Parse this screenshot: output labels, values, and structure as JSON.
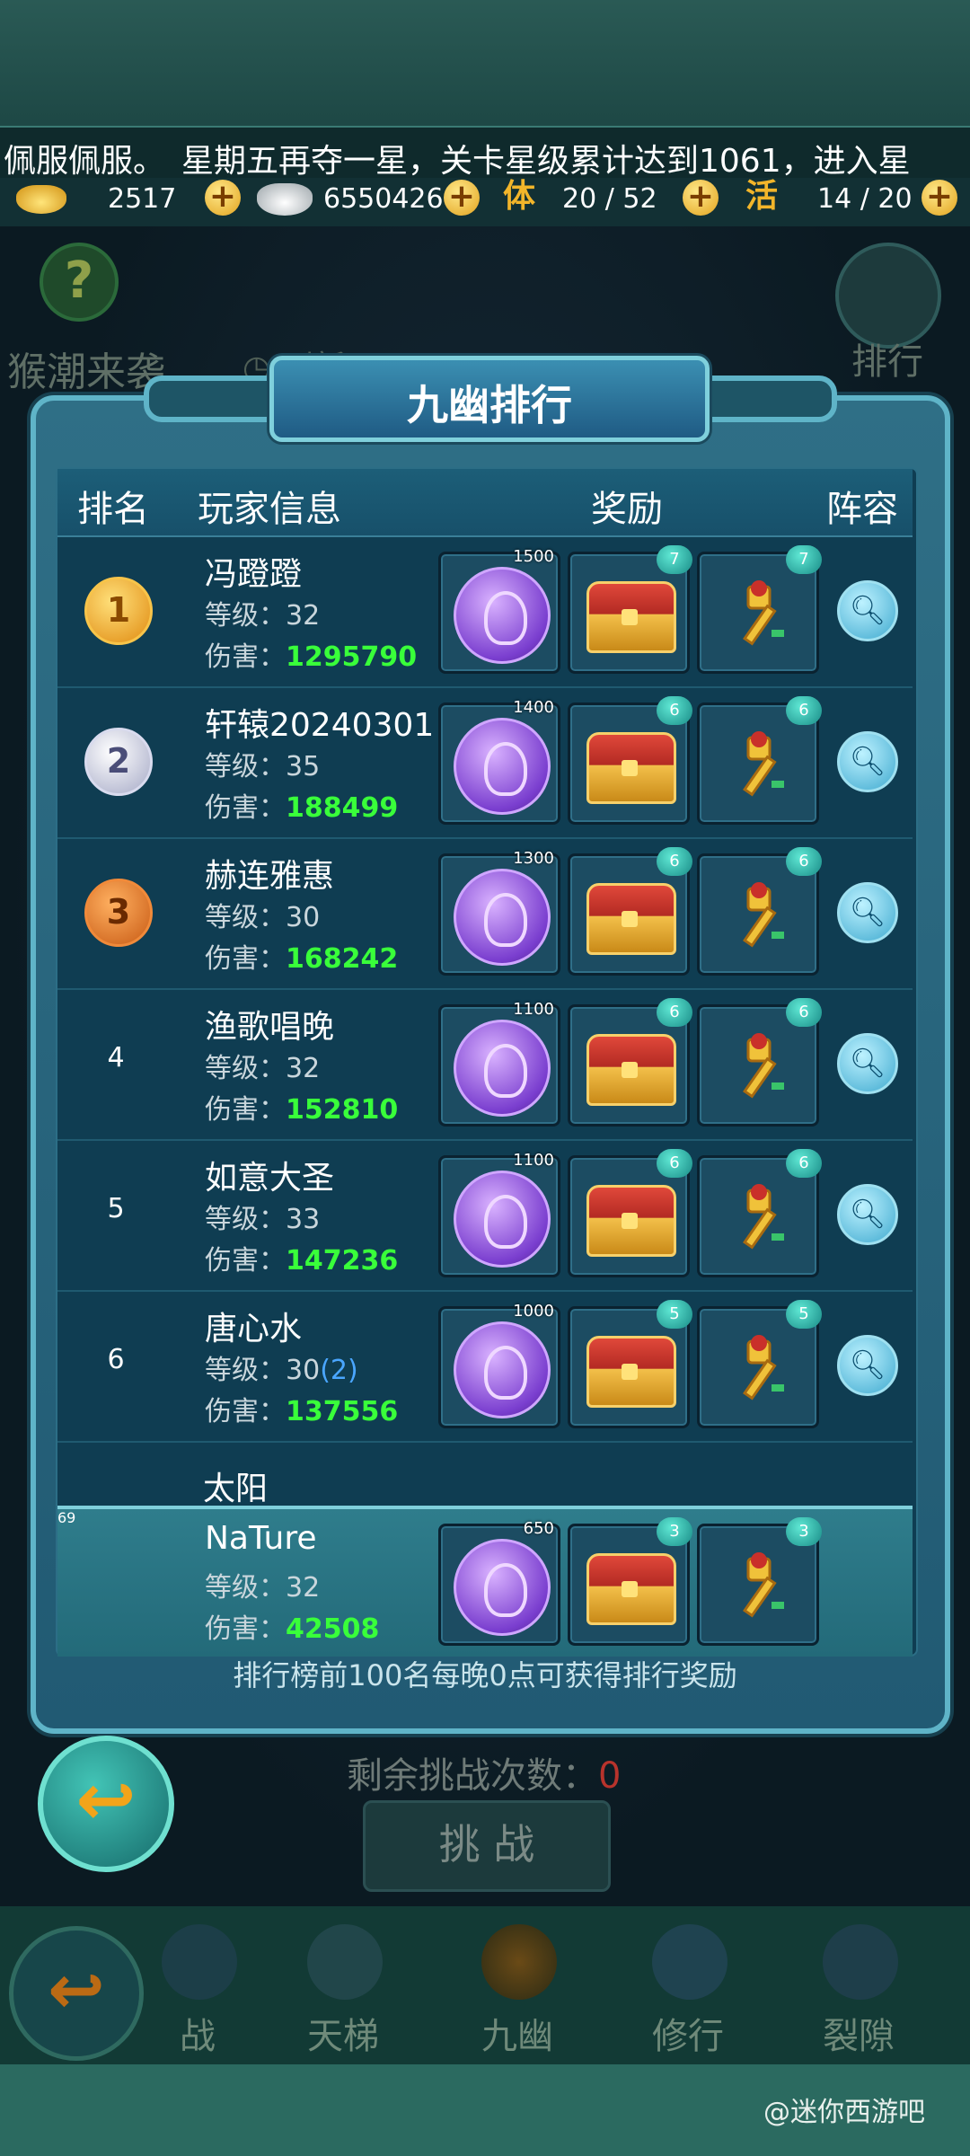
{
  "marquee": "佩服佩服。　星期五再夺一星，关卡星级累计达到1061，进入星",
  "resources": {
    "gold": "2517",
    "silver": "6550426",
    "stamina_label": "体",
    "stamina": "20 / 52",
    "activity_label": "活",
    "activity": "14 / 20"
  },
  "background": {
    "event_title": "猴潮来袭",
    "event_sub": "◷ 刷新",
    "help": "?",
    "rank_button": "排行"
  },
  "panel": {
    "title": "九幽排行",
    "headers": {
      "rank": "排名",
      "player": "玩家信息",
      "reward": "奖励",
      "lineup": "阵容"
    },
    "level_label": "等级：",
    "damage_label": "伤害：",
    "rows": [
      {
        "rank": "1",
        "name": "冯蹬蹬",
        "level": "32",
        "level_extra": "",
        "damage": "1295790",
        "coin": "1500",
        "chest": "7",
        "key": "7"
      },
      {
        "rank": "2",
        "name": "轩辕20240301",
        "level": "35",
        "level_extra": "",
        "damage": "188499",
        "coin": "1400",
        "chest": "6",
        "key": "6"
      },
      {
        "rank": "3",
        "name": "赫连雅惠",
        "level": "30",
        "level_extra": "",
        "damage": "168242",
        "coin": "1300",
        "chest": "6",
        "key": "6"
      },
      {
        "rank": "4",
        "name": "渔歌唱晚",
        "level": "32",
        "level_extra": "",
        "damage": "152810",
        "coin": "1100",
        "chest": "6",
        "key": "6"
      },
      {
        "rank": "5",
        "name": "如意大圣",
        "level": "33",
        "level_extra": "",
        "damage": "147236",
        "coin": "1100",
        "chest": "6",
        "key": "6"
      },
      {
        "rank": "6",
        "name": "唐心水",
        "level": "30",
        "level_extra": "(2)",
        "damage": "137556",
        "coin": "1000",
        "chest": "5",
        "key": "5"
      }
    ],
    "partial_next_name": "太阳",
    "self_row": {
      "rank": "69",
      "name": "NaTure",
      "level": "32",
      "damage": "42508",
      "coin": "650",
      "chest": "3",
      "key": "3"
    },
    "footer": "排行榜前100名每晚0点可获得排行奖励"
  },
  "remaining": {
    "label": "剩余挑战次数：",
    "value": "0"
  },
  "challenge_button": "挑 战",
  "nav": [
    "战",
    "天梯",
    "九幽",
    "修行",
    "裂隙"
  ],
  "watermark": "@迷你西游吧"
}
